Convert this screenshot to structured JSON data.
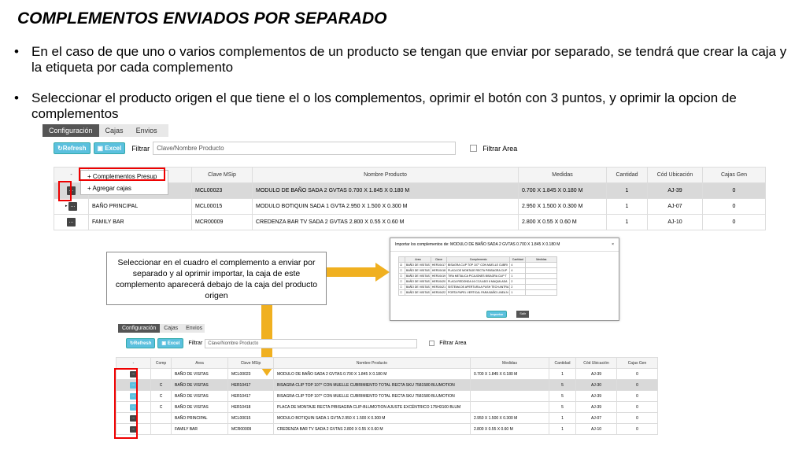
{
  "slide": {
    "title": "COMPLEMENTOS ENVIADOS POR SEPARADO",
    "bullet1": "En el caso de que uno o varios complementos de un producto se tengan que enviar por separado, se tendrá que crear la caja y la etiqueta por cada complemento",
    "bullet2": "Seleccionar el producto origen el que tiene el o los complementos, oprimir el botón con 3 puntos, y oprimir la opcion de complementos",
    "bullet_char": "•"
  },
  "app": {
    "tabs": [
      "Configuración",
      "Cajas",
      "Envios"
    ],
    "refresh_label": "↻Refresh",
    "excel_label": "▣ Excel",
    "filter_label": "Filtrar",
    "filter_placeholder": "Clave/Nombre Producto",
    "filter_area_label": "Filtrar Area",
    "dots": "..."
  },
  "top_grid": {
    "columns": [
      "-",
      "",
      "Clave MSip",
      "Nombre Producto",
      "Medidas",
      "Cantidad",
      "Cód Ubicación",
      "Cajas Gen"
    ],
    "menu": [
      "+ Complementos Presup",
      "+ Agregar cajas"
    ],
    "rows": [
      {
        "area": "",
        "clave": "MCL00023",
        "nombre": "MODULO DE BAÑO SADA 2 GVTAS 0.700 X 1.845 X 0.180 M",
        "medidas": "0.700 X 1.845 X 0.180 M",
        "cantidad": "1",
        "ubicacion": "AJ-39",
        "cajas": "0"
      },
      {
        "area": "BAÑO PRINCIPAL",
        "clave": "MCL00015",
        "nombre": "MODULO BOTIQUIN SADA 1 GVTA 2.950 X 1.500 X 0.300 M",
        "medidas": "2.950 X 1.500 X 0.300 M",
        "cantidad": "1",
        "ubicacion": "AJ-07",
        "cajas": "0"
      },
      {
        "area": "FAMILY BAR",
        "clave": "MCR00009",
        "nombre": "CREDENZA BAR TV SADA 2 GVTAS 2.800 X 0.55 X 0.60 M",
        "medidas": "2.800 X 0.55 X 0.60 M",
        "cantidad": "1",
        "ubicacion": "AJ-10",
        "cajas": "0"
      }
    ]
  },
  "callout": "Seleccionar en el cuadro el complemento  a enviar por separado y al oprimir importar,  la caja de este complemento  aparecerá debajo de la caja del producto  origen",
  "modal": {
    "title": "Importar los complementos de: MODULO DE BAÑO SADA 2 GVTAS 0.700 X 1.845 X 0.180 M",
    "close": "×",
    "columns": [
      "",
      "Area",
      "Clave",
      "Complemento",
      "Cantidad",
      "Medidas"
    ],
    "rows": [
      [
        "BAÑO DE VISITAS",
        "HER10417",
        "BISAGRA CLIP TOP 107° CON MUELLE CUBRI",
        "4"
      ],
      [
        "BAÑO DE VISITAS",
        "HER10418",
        "PLACA DE MONTAJE RECTA P/BISAGRA CLIP",
        "4"
      ],
      [
        "BAÑO DE VISITAS",
        "HER10419",
        "TIRA METALICA P/CAJONES BISAGRA CLIP T",
        "1"
      ],
      [
        "BAÑO DE VISITAS",
        "HER10420",
        "PLACA REDONDA 16 CC/LADO 6 MAQUILADA",
        "2"
      ],
      [
        "BAÑO DE VISITAS",
        "HER10421",
        "SISTEMA DE APERTURA A PUSH TECH ANTRA",
        "2"
      ],
      [
        "BAÑO DE VISITAS",
        "HER10422",
        "PORTA PAPEL VERTICAL PARA BAÑO LINEA N",
        "1"
      ]
    ],
    "import_label": "Importar",
    "exit_label": "Salir"
  },
  "bottom_grid": {
    "columns": [
      "-",
      "Comp",
      "Area",
      "Clave MSip",
      "Nombre Producto",
      "Medidas",
      "Cantidad",
      "Cód Ubicación",
      "Cajas Gen"
    ],
    "rows": [
      {
        "btn": "dark",
        "comp": "",
        "area": "BAÑO DE VISITAS",
        "clave": "MCL00023",
        "nombre": "MODULO DE BAÑO SADA 2 GVTAS 0.700 X 1.845 X 0.180 M",
        "medidas": "0.700 X 1.845 X 0.180 M",
        "cantidad": "1",
        "ubicacion": "AJ-39",
        "cajas": "0"
      },
      {
        "btn": "blue",
        "comp": "C",
        "area": "BAÑO DE VISITAS",
        "clave": "HER10417",
        "nombre": "BISAGRA CLIP TOP 107° CON MUELLE CUBRIMIENTO TOTAL RECTA SKU 7581580 BLUMOTION",
        "medidas": "",
        "cantidad": "5",
        "ubicacion": "AJ-30",
        "cajas": "0"
      },
      {
        "btn": "blue",
        "comp": "C",
        "area": "BAÑO DE VISITAS",
        "clave": "HER10417",
        "nombre": "BISAGRA CLIP TOP 107° CON MUELLE CUBRIMIENTO TOTAL RECTA SKU 7581580 BLUMOTION",
        "medidas": "",
        "cantidad": "5",
        "ubicacion": "AJ-39",
        "cajas": "0"
      },
      {
        "btn": "blue",
        "comp": "C",
        "area": "BAÑO DE VISITAS",
        "clave": "HER10418",
        "nombre": "PLACA DE MONTAJE RECTA P/BISAGRA CLIP-BLUMOTION AJUSTE EXCÉNTRICO 175H3100 BLUM",
        "medidas": "",
        "cantidad": "5",
        "ubicacion": "AJ-39",
        "cajas": "0"
      },
      {
        "btn": "dark",
        "comp": "",
        "area": "BAÑO PRINCIPAL",
        "clave": "MCL00015",
        "nombre": "MODULO BOTIQUIN SADA 1 GVTA 2.950 X 1.500 X 0.300 M",
        "medidas": "2.950 X 1.500 X 0.300 M",
        "cantidad": "1",
        "ubicacion": "AJ-07",
        "cajas": "0"
      },
      {
        "btn": "dark",
        "comp": "",
        "area": "FAMILY BAR",
        "clave": "MCR00009",
        "nombre": "CREDENZA BAR TV SADA 2 GVTAS 2.800 X 0.55 X 0.60 M",
        "medidas": "2.800 X 0.55 X 0.60 M",
        "cantidad": "1",
        "ubicacion": "AJ-10",
        "cajas": "0"
      }
    ]
  },
  "colors": {
    "arrow": "#f0b020",
    "highlight": "#e00000",
    "accent": "#5bc0de"
  }
}
